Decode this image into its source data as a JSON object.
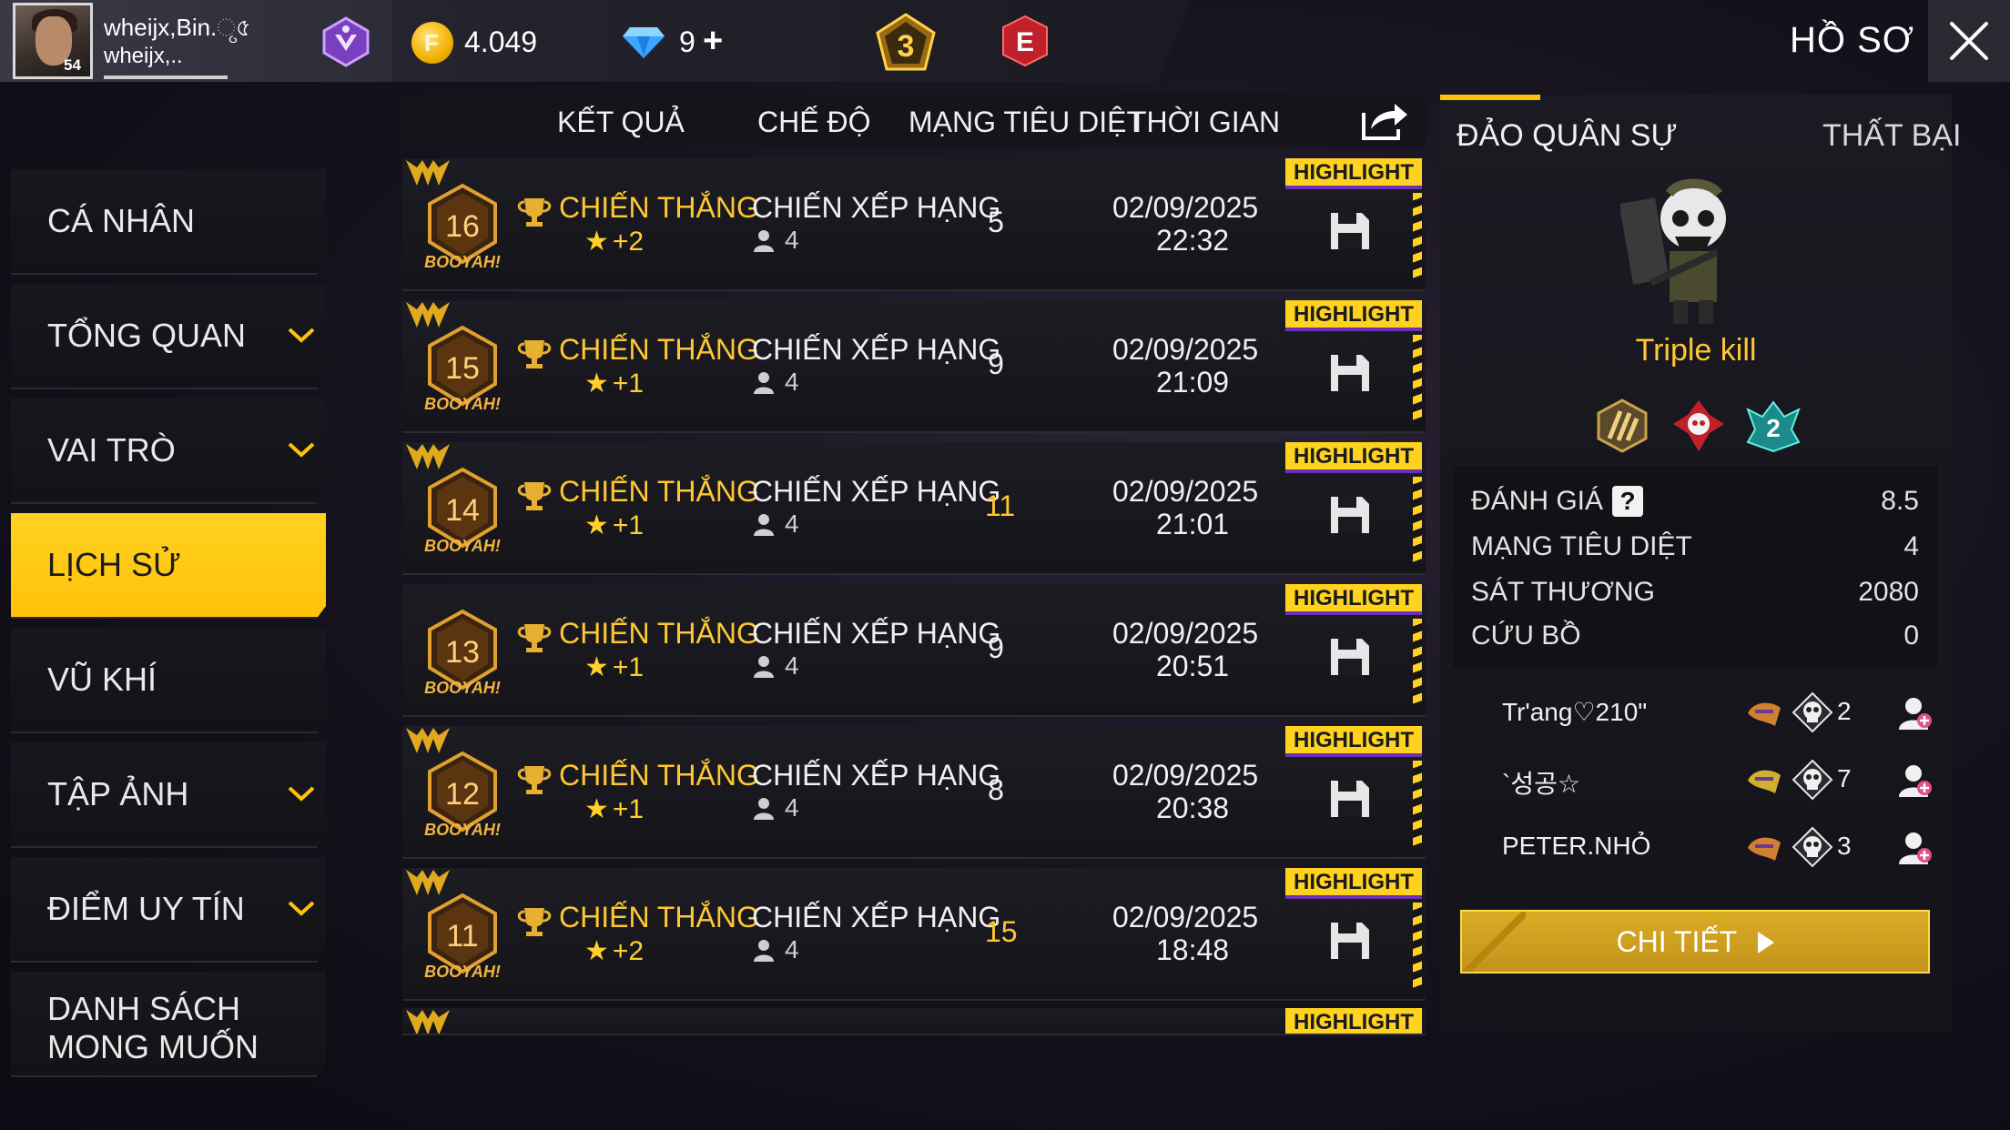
{
  "player": {
    "name": "wheijx,Bin.ୃ৫",
    "guild": "wheijx,..",
    "level": "54"
  },
  "currency": {
    "gold": "4.049",
    "diamonds": "9",
    "diamond_add": "+"
  },
  "header": {
    "rank_number": "3",
    "rank_letter": "E",
    "title": "HỒ SƠ"
  },
  "sidebar": {
    "items": [
      {
        "label": "CÁ NHÂN",
        "has_chevron": false,
        "active": false
      },
      {
        "label": "TỔNG QUAN",
        "has_chevron": true,
        "active": false
      },
      {
        "label": "VAI TRÒ",
        "has_chevron": true,
        "active": false
      },
      {
        "label": "LỊCH SỬ",
        "has_chevron": false,
        "active": true
      },
      {
        "label": "VŨ KHÍ",
        "has_chevron": false,
        "active": false
      },
      {
        "label": "TẬP ẢNH",
        "has_chevron": true,
        "active": false
      },
      {
        "label": "ĐIỂM UY TÍN",
        "has_chevron": true,
        "active": false
      },
      {
        "label": "DANH SÁCH MONG MUỐN",
        "has_chevron": false,
        "active": false
      }
    ]
  },
  "table": {
    "headers": [
      "KẾT QUẢ",
      "CHẾ ĐỘ",
      "MẠNG TIÊU DIỆT",
      "THỜI GIAN"
    ],
    "highlight_label": "HIGHLIGHT",
    "badge_text": "BOOYAH!",
    "rows": [
      {
        "rank": "16",
        "result": "CHIẾN THẮNG",
        "points": "+2",
        "mode": "CHIẾN XẾP HẠNG",
        "squad": "4",
        "kills": "5",
        "kills_gold": false,
        "date": "02/09/2025",
        "time": "22:32",
        "wing": true
      },
      {
        "rank": "15",
        "result": "CHIẾN THẮNG",
        "points": "+1",
        "mode": "CHIẾN XẾP HẠNG",
        "squad": "4",
        "kills": "9",
        "kills_gold": false,
        "date": "02/09/2025",
        "time": "21:09",
        "wing": true
      },
      {
        "rank": "14",
        "result": "CHIẾN THẮNG",
        "points": "+1",
        "mode": "CHIẾN XẾP HẠNG",
        "squad": "4",
        "kills": "11",
        "kills_gold": true,
        "date": "02/09/2025",
        "time": "21:01",
        "wing": true
      },
      {
        "rank": "13",
        "result": "CHIẾN THẮNG",
        "points": "+1",
        "mode": "CHIẾN XẾP HẠNG",
        "squad": "4",
        "kills": "9",
        "kills_gold": false,
        "date": "02/09/2025",
        "time": "20:51",
        "wing": false
      },
      {
        "rank": "12",
        "result": "CHIẾN THẮNG",
        "points": "+1",
        "mode": "CHIẾN XẾP HẠNG",
        "squad": "4",
        "kills": "8",
        "kills_gold": false,
        "date": "02/09/2025",
        "time": "20:38",
        "wing": true
      },
      {
        "rank": "11",
        "result": "CHIẾN THẮNG",
        "points": "+2",
        "mode": "CHIẾN XẾP HẠNG",
        "squad": "4",
        "kills": "15",
        "kills_gold": true,
        "date": "02/09/2025",
        "time": "18:48",
        "wing": true
      }
    ]
  },
  "detail": {
    "map": "ĐẢO QUÂN SỰ",
    "result": "THẤT BẠI",
    "achievement": "Triple kill",
    "stats": [
      {
        "label": "ĐÁNH GIÁ",
        "value": "8.5",
        "help": "?"
      },
      {
        "label": "MẠNG TIÊU DIỆT",
        "value": "4"
      },
      {
        "label": "SÁT THƯƠNG",
        "value": "2080"
      },
      {
        "label": "CỨU BỒ",
        "value": "0"
      }
    ],
    "teammates": [
      {
        "name": "Tr'ang♡210\"",
        "kills": "2"
      },
      {
        "name": "`성공☆",
        "kills": "7"
      },
      {
        "name": "PETER.NHỎ",
        "kills": "3"
      }
    ],
    "detail_button": "CHI TIẾT"
  },
  "colors": {
    "accent": "#ffc20a",
    "gold_text": "#ffc832",
    "highlight_border": "#6b2fb8"
  }
}
